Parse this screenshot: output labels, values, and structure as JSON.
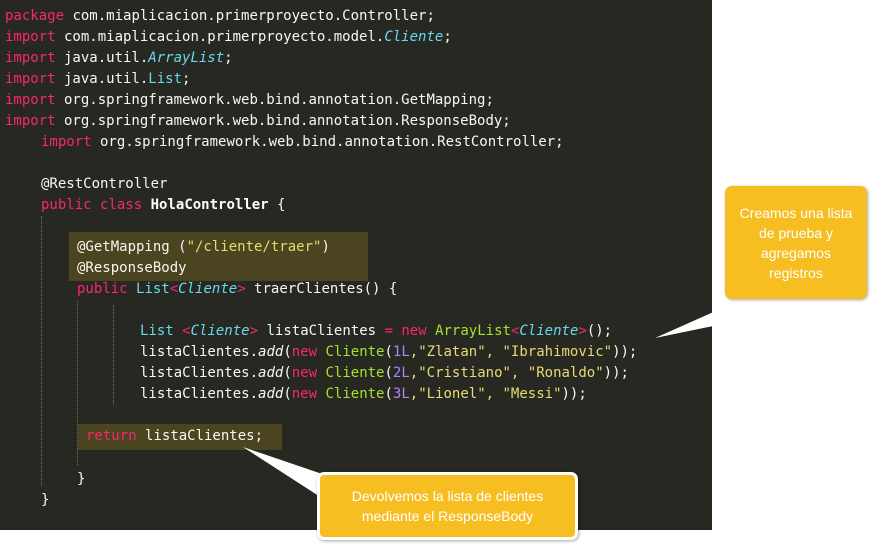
{
  "colors": {
    "background": "#272822",
    "keyword": "#f92672",
    "type": "#66d9ef",
    "class_name": "#a6e22e",
    "string": "#e6db74",
    "number": "#ae81ff",
    "text": "#f8f8f2",
    "highlight": "#4a4420",
    "callout": "#f7be22"
  },
  "code": {
    "l1": {
      "kw": "package",
      "rest": " com.miaplicacion.primerproyecto.Controller;"
    },
    "l2": {
      "kw": "import",
      "pre": " com.miaplicacion.primerproyecto.model.",
      "type": "Cliente",
      "post": ";"
    },
    "l3": {
      "kw": "import",
      "pre": " java.util.",
      "type": "ArrayList",
      "post": ";"
    },
    "l4": {
      "kw": "import",
      "pre": " java.util.",
      "type": "List",
      "post": ";"
    },
    "l5": {
      "kw": "import",
      "rest": " org.springframework.web.bind.annotation.GetMapping;"
    },
    "l6": {
      "kw": "import",
      "rest": " org.springframework.web.bind.annotation.ResponseBody;"
    },
    "l7": {
      "kw": "import",
      "rest": " org.springframework.web.bind.annotation.RestController;"
    },
    "l8": {
      "text": "@RestController"
    },
    "l9": {
      "kw1": "public",
      "kw2": "class",
      "name": "HolaController",
      "brace": " {"
    },
    "l10": {
      "ann": "@GetMapping (",
      "str": "\"/cliente/traer\"",
      "close": ")"
    },
    "l11": {
      "text": "@ResponseBody"
    },
    "l12": {
      "kw": "public",
      "list": "List",
      "lt": "<",
      "type": "Cliente",
      "gt": ">",
      "rest": " traerClientes() {"
    },
    "l13": {
      "list": "List ",
      "lt": "<",
      "type": "Cliente",
      "gt": ">",
      "var": " listaClientes ",
      "eq": "=",
      "new": " new ",
      "cls": "ArrayList",
      "lt2": "<",
      "type2": "Cliente",
      "gt2": ">",
      "end": "();"
    },
    "l14": {
      "var": "listaClientes.",
      "method": "add",
      "open": "(",
      "new": "new",
      "cls": " Cliente",
      "p": "(",
      "num": "1L",
      "args": ",\"Zlatan\", \"Ibrahimovic\"",
      "end": "));"
    },
    "l15": {
      "var": "listaClientes.",
      "method": "add",
      "open": "(",
      "new": "new",
      "cls": " Cliente",
      "p": "(",
      "num": "2L",
      "args": ",\"Cristiano\", \"Ronaldo\"",
      "end": "));"
    },
    "l16": {
      "var": "listaClientes.",
      "method": "add",
      "open": "(",
      "new": "new",
      "cls": " Cliente",
      "p": "(",
      "num": "3L",
      "args": ",\"Lionel\", \"Messi\"",
      "end": "));"
    },
    "l17": {
      "kw": "return",
      "rest": " listaClientes;"
    },
    "l18": {
      "text": "}"
    },
    "l19": {
      "text": "}"
    }
  },
  "callouts": {
    "c1": "Creamos una lista de prueba y agregamos registros",
    "c2": "Devolvemos la lista de clientes mediante el ResponseBody"
  }
}
